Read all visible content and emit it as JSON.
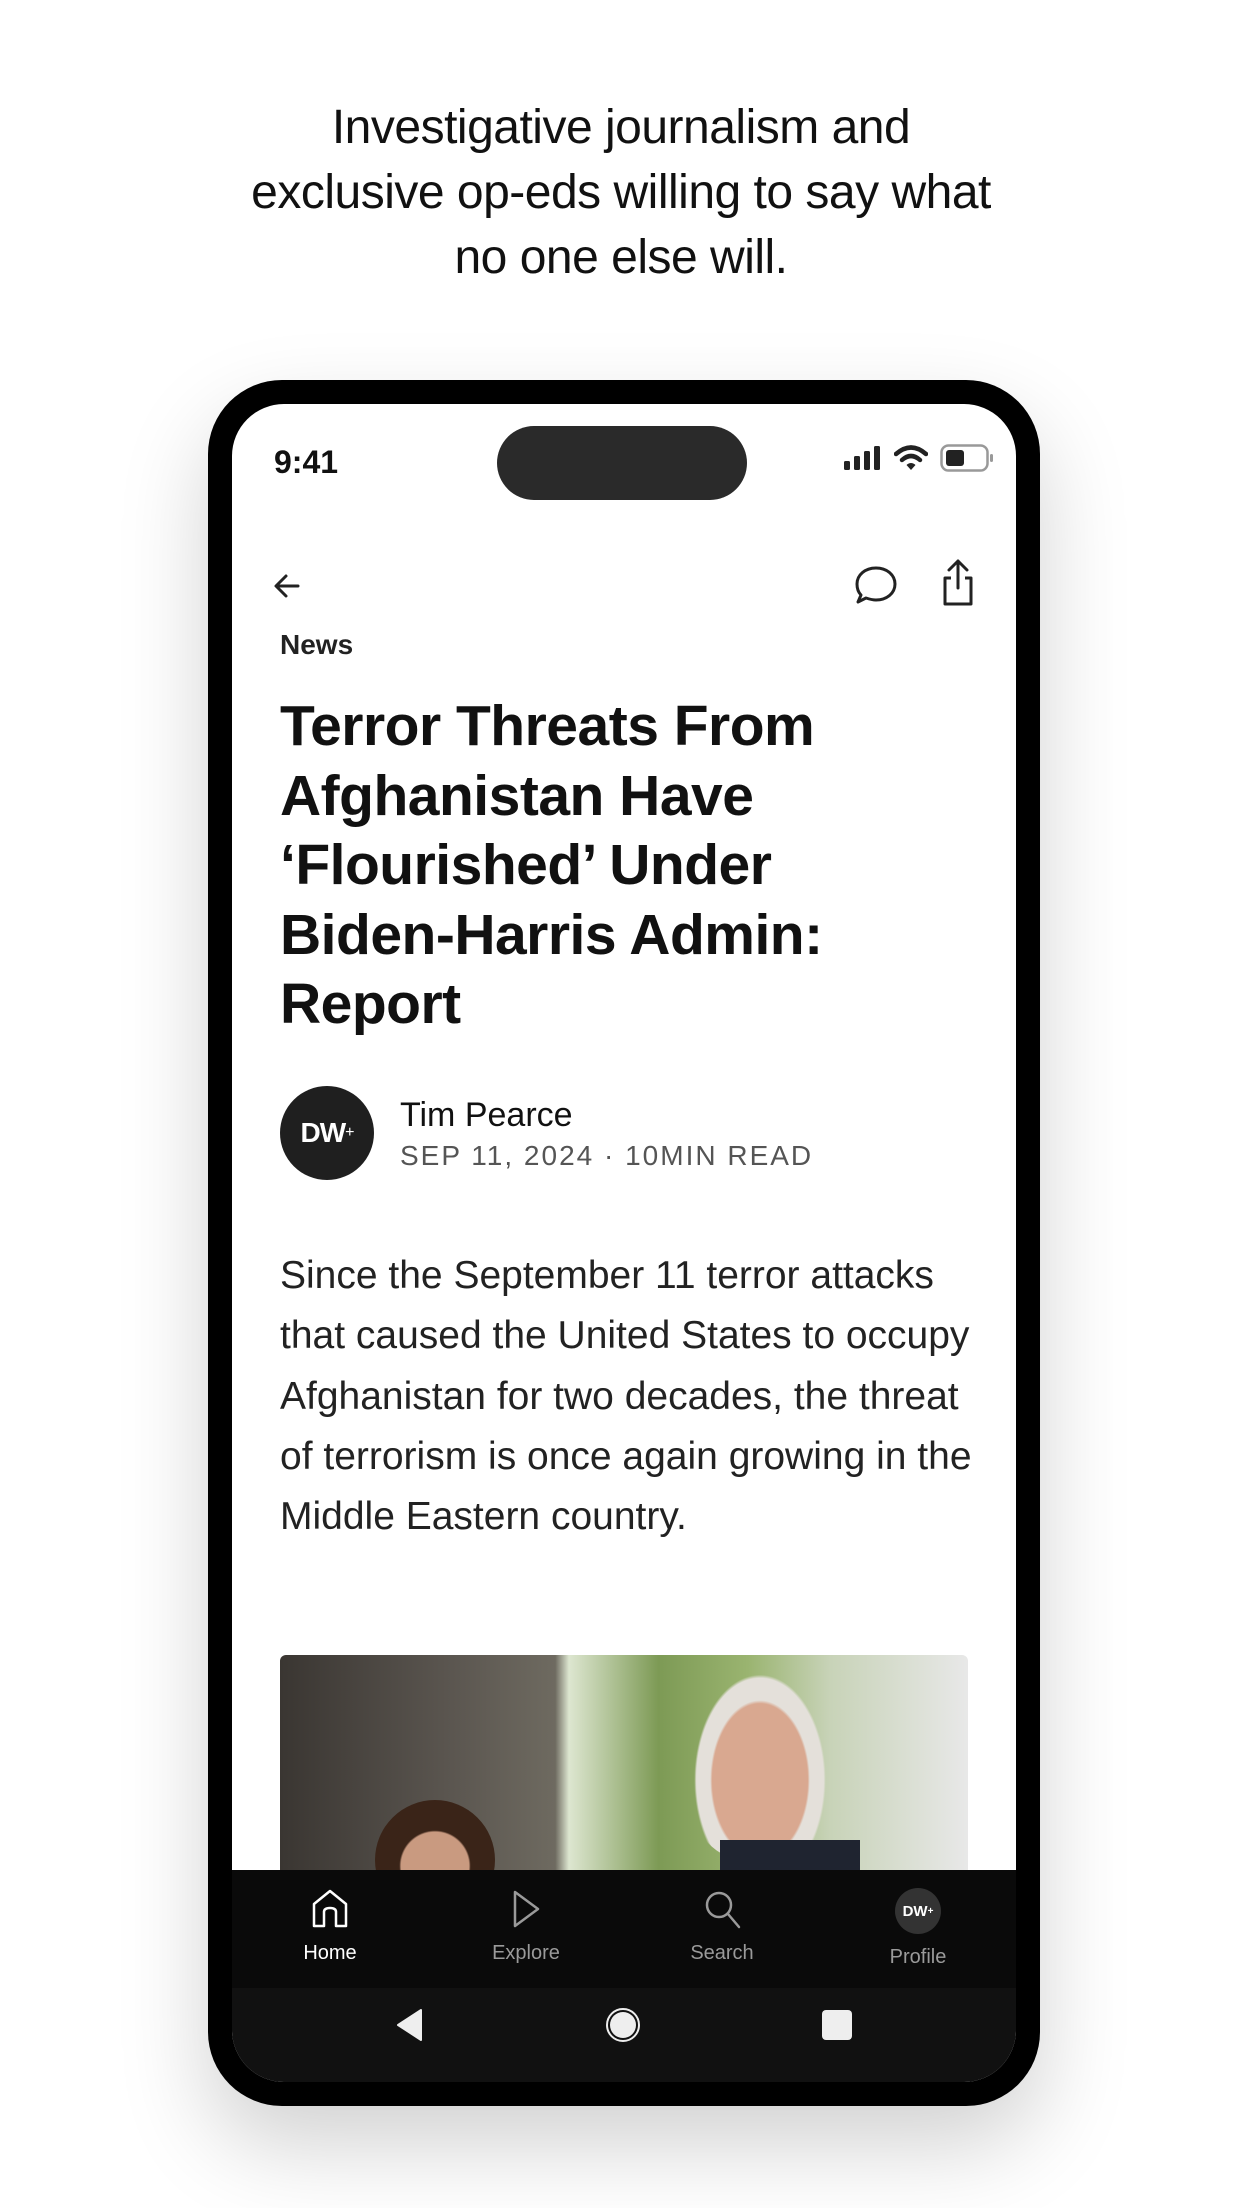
{
  "tagline": [
    "Investigative journalism and",
    "exclusive op-eds willing to say what",
    "no one else will."
  ],
  "status_bar": {
    "time": "9:41",
    "icons": [
      "cellular-signal-icon",
      "wifi-icon",
      "battery-icon"
    ]
  },
  "article": {
    "category": "News",
    "headline": "Terror Threats From Afghanistan Have ‘Flourished’ Under Biden-Harris Admin: Report",
    "author": {
      "avatar_text": "DW",
      "name": "Tim Pearce",
      "date": "SEP 11, 2024",
      "separator": "·",
      "read_time": "10MIN READ"
    },
    "body": "Since the September 11 terror attacks that caused the United States to occupy Afghanistan for two decades, the threat of terrorism is once again growing in the Middle Eastern country."
  },
  "tabs": [
    {
      "label": "Home",
      "icon": "home-icon",
      "active": true
    },
    {
      "label": "Explore",
      "icon": "play-icon",
      "active": false
    },
    {
      "label": "Search",
      "icon": "search-icon",
      "active": false
    },
    {
      "label": "Profile",
      "icon": "profile-avatar",
      "avatar_text": "DW",
      "active": false
    }
  ],
  "colors": {
    "tabbar_bg": "#0a0a0a",
    "active_tab": "#ffffff",
    "inactive_tab": "#9a9a9a"
  }
}
